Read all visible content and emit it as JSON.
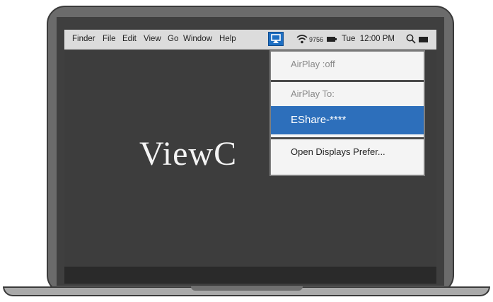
{
  "menubar": {
    "items": [
      "Finder",
      "File",
      "Edit",
      "View",
      "Go",
      "Window",
      "Help"
    ],
    "wifi_ssid": "9756",
    "clock": "Tue  12:00 PM"
  },
  "logo": {
    "text": "ViewC"
  },
  "airplay_menu": {
    "status": "AirPlay :off",
    "heading": "AirPlay To:",
    "device": "EShare-****",
    "open_prefs": "Open Displays Prefer..."
  },
  "icons": {
    "airplay": "airplay-display-icon",
    "wifi": "wifi-icon",
    "battery": "battery-icon",
    "search": "search-icon",
    "display": "display-icon"
  },
  "colors": {
    "selection": "#2d6fbb",
    "airplay_button": "#1e6fc2",
    "screen": "#3d3d3d",
    "menubar": "#dcdcdc"
  }
}
